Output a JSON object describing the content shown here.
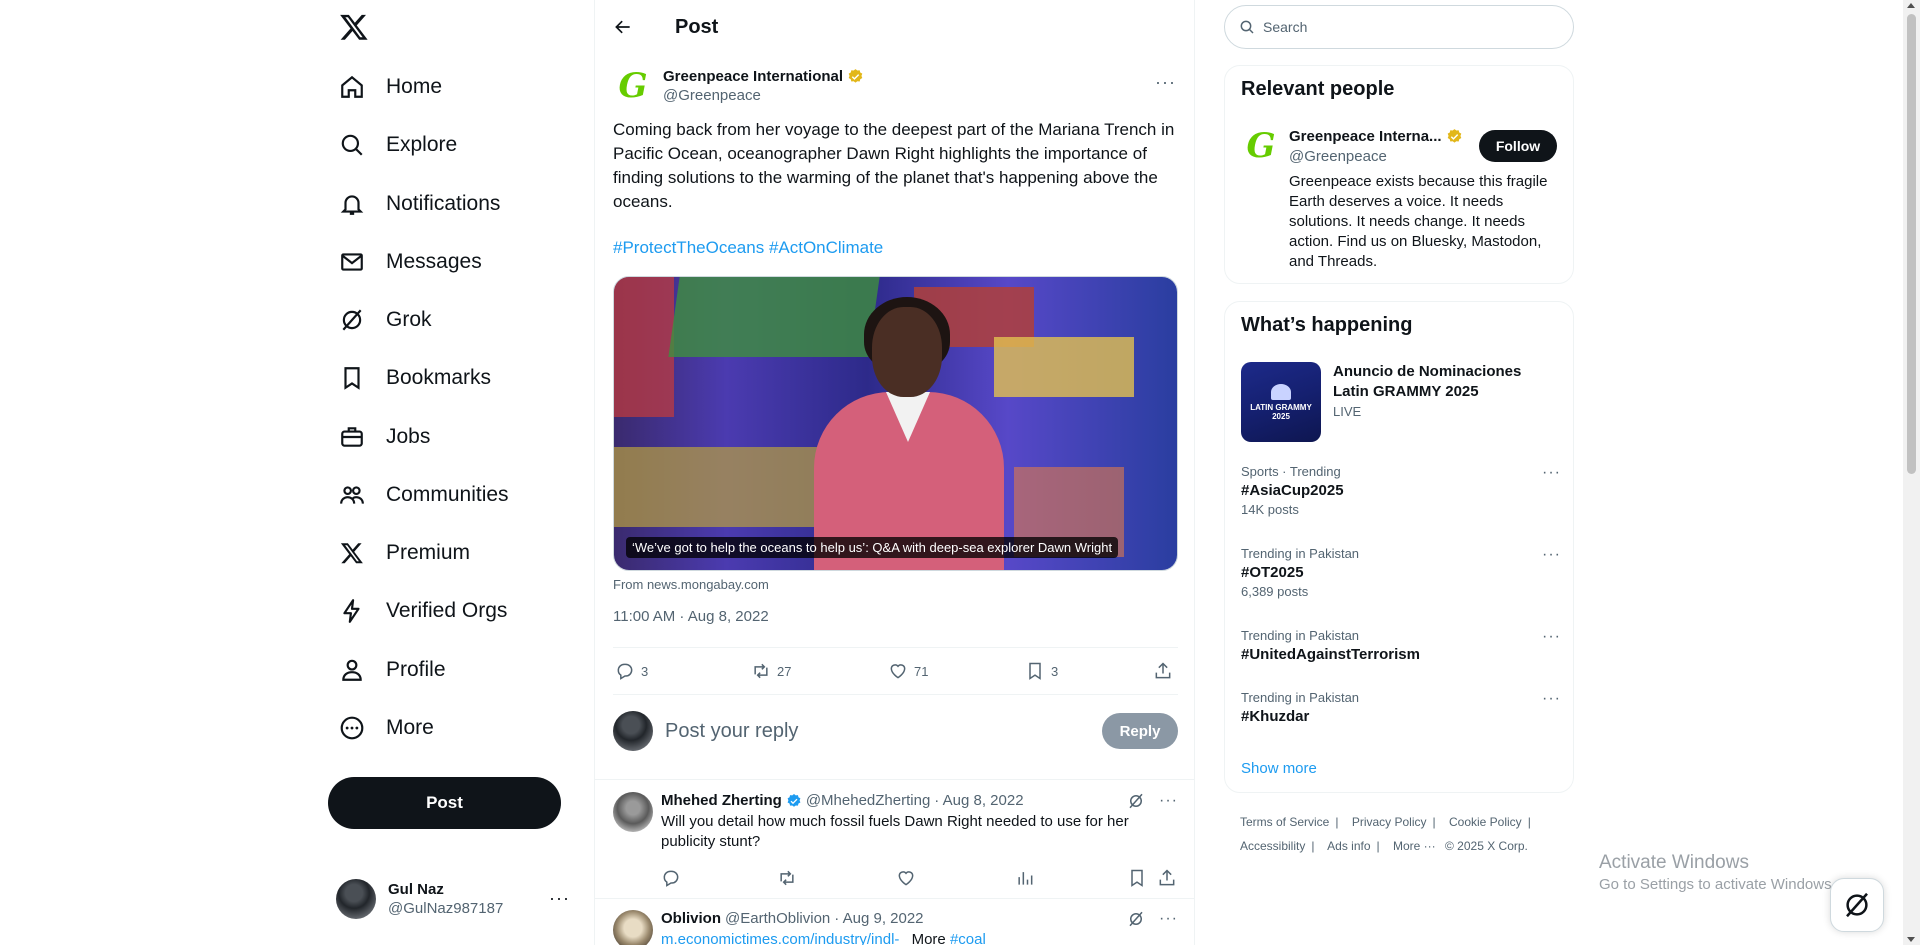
{
  "nav": {
    "items": [
      {
        "label": "Home",
        "icon": "home-icon"
      },
      {
        "label": "Explore",
        "icon": "search-icon"
      },
      {
        "label": "Notifications",
        "icon": "bell-icon"
      },
      {
        "label": "Messages",
        "icon": "envelope-icon"
      },
      {
        "label": "Grok",
        "icon": "grok-icon"
      },
      {
        "label": "Bookmarks",
        "icon": "bookmark-icon"
      },
      {
        "label": "Jobs",
        "icon": "briefcase-icon"
      },
      {
        "label": "Communities",
        "icon": "people-icon"
      },
      {
        "label": "Premium",
        "icon": "x-logo-icon"
      },
      {
        "label": "Verified Orgs",
        "icon": "lightning-icon"
      },
      {
        "label": "Profile",
        "icon": "person-icon"
      },
      {
        "label": "More",
        "icon": "more-circle-icon"
      }
    ],
    "post_button": "Post",
    "account": {
      "name": "Gul Naz",
      "handle": "@GulNaz987187"
    }
  },
  "main": {
    "title": "Post",
    "post": {
      "author_name": "Greenpeace International",
      "author_handle": "@Greenpeace",
      "avatar_letter": "G",
      "text": "Coming back from her voyage to the deepest part of the Mariana Trench in Pacific Ocean, oceanographer Dawn Right highlights the importance of finding solutions to the warming of the planet that's happening above the oceans.",
      "hashtags": [
        "#ProtectTheOceans",
        "#ActOnClimate"
      ],
      "card_caption": "‘We’ve got to help the oceans to help us’: Q&A with deep-sea explorer Dawn Wright",
      "card_source": "From news.mongabay.com",
      "timestamp": "11:00 AM · Aug 8, 2022",
      "stats": {
        "replies": "3",
        "reposts": "27",
        "likes": "71",
        "bookmarks": "3"
      }
    },
    "reply_box": {
      "placeholder": "Post your reply",
      "button": "Reply"
    },
    "replies": [
      {
        "name": "Mhehed Zherting",
        "handle": "@MhehedZherting",
        "date": "· Aug 8, 2022",
        "text": "Will you detail how much fossil fuels Dawn Right needed to use for her publicity stunt?"
      },
      {
        "name": "Oblivion",
        "handle": "@EarthOblivion",
        "date": "· Aug 9, 2022",
        "text_link": "m.economictimes.com/industry/indl-",
        "text_more": "More",
        "text_tag": "#coal"
      }
    ]
  },
  "right": {
    "search_placeholder": "Search",
    "relevant": {
      "heading": "Relevant people",
      "name": "Greenpeace Interna...",
      "handle": "@Greenpeace",
      "avatar_letter": "G",
      "follow": "Follow",
      "bio": "Greenpeace exists because this fragile Earth deserves a voice. It needs solutions. It needs change. It needs action. Find us on Bluesky, Mastodon, and Threads."
    },
    "happening": {
      "heading": "What’s happening",
      "featured": {
        "title": "Anuncio de Nominaciones Latin GRAMMY 2025",
        "status": "LIVE",
        "thumb_text": "LATIN GRAMMY 2025"
      },
      "trends": [
        {
          "context": "Sports · Trending",
          "topic": "#AsiaCup2025",
          "count": "14K posts"
        },
        {
          "context": "Trending in Pakistan",
          "topic": "#OT2025",
          "count": "6,389 posts"
        },
        {
          "context": "Trending in Pakistan",
          "topic": "#UnitedAgainstTerrorism",
          "count": ""
        },
        {
          "context": "Trending in Pakistan",
          "topic": "#Khuzdar",
          "count": ""
        }
      ],
      "show_more": "Show more"
    },
    "footer": [
      "Terms of Service",
      "Privacy Policy",
      "Cookie Policy",
      "Accessibility",
      "Ads info",
      "More ···",
      "© 2025 X Corp."
    ]
  },
  "overlay": {
    "activate_title": "Activate Windows",
    "activate_sub": "Go to Settings to activate Windows."
  },
  "colors": {
    "accent": "#1d9bf0",
    "text": "#0f1419",
    "muted": "#536471",
    "greenpeace": "#66cc00",
    "verified_gold": "#e2b719"
  }
}
